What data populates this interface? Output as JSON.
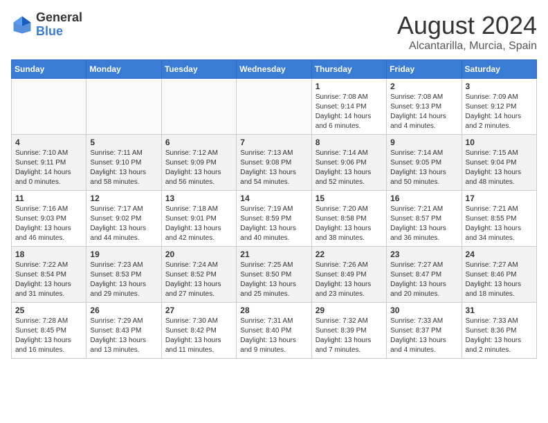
{
  "header": {
    "logo": {
      "general": "General",
      "blue": "Blue"
    },
    "title": "August 2024",
    "location": "Alcantarilla, Murcia, Spain"
  },
  "calendar": {
    "weekdays": [
      "Sunday",
      "Monday",
      "Tuesday",
      "Wednesday",
      "Thursday",
      "Friday",
      "Saturday"
    ],
    "weeks": [
      [
        {
          "day": "",
          "info": ""
        },
        {
          "day": "",
          "info": ""
        },
        {
          "day": "",
          "info": ""
        },
        {
          "day": "",
          "info": ""
        },
        {
          "day": "1",
          "info": "Sunrise: 7:08 AM\nSunset: 9:14 PM\nDaylight: 14 hours\nand 6 minutes."
        },
        {
          "day": "2",
          "info": "Sunrise: 7:08 AM\nSunset: 9:13 PM\nDaylight: 14 hours\nand 4 minutes."
        },
        {
          "day": "3",
          "info": "Sunrise: 7:09 AM\nSunset: 9:12 PM\nDaylight: 14 hours\nand 2 minutes."
        }
      ],
      [
        {
          "day": "4",
          "info": "Sunrise: 7:10 AM\nSunset: 9:11 PM\nDaylight: 14 hours\nand 0 minutes."
        },
        {
          "day": "5",
          "info": "Sunrise: 7:11 AM\nSunset: 9:10 PM\nDaylight: 13 hours\nand 58 minutes."
        },
        {
          "day": "6",
          "info": "Sunrise: 7:12 AM\nSunset: 9:09 PM\nDaylight: 13 hours\nand 56 minutes."
        },
        {
          "day": "7",
          "info": "Sunrise: 7:13 AM\nSunset: 9:08 PM\nDaylight: 13 hours\nand 54 minutes."
        },
        {
          "day": "8",
          "info": "Sunrise: 7:14 AM\nSunset: 9:06 PM\nDaylight: 13 hours\nand 52 minutes."
        },
        {
          "day": "9",
          "info": "Sunrise: 7:14 AM\nSunset: 9:05 PM\nDaylight: 13 hours\nand 50 minutes."
        },
        {
          "day": "10",
          "info": "Sunrise: 7:15 AM\nSunset: 9:04 PM\nDaylight: 13 hours\nand 48 minutes."
        }
      ],
      [
        {
          "day": "11",
          "info": "Sunrise: 7:16 AM\nSunset: 9:03 PM\nDaylight: 13 hours\nand 46 minutes."
        },
        {
          "day": "12",
          "info": "Sunrise: 7:17 AM\nSunset: 9:02 PM\nDaylight: 13 hours\nand 44 minutes."
        },
        {
          "day": "13",
          "info": "Sunrise: 7:18 AM\nSunset: 9:01 PM\nDaylight: 13 hours\nand 42 minutes."
        },
        {
          "day": "14",
          "info": "Sunrise: 7:19 AM\nSunset: 8:59 PM\nDaylight: 13 hours\nand 40 minutes."
        },
        {
          "day": "15",
          "info": "Sunrise: 7:20 AM\nSunset: 8:58 PM\nDaylight: 13 hours\nand 38 minutes."
        },
        {
          "day": "16",
          "info": "Sunrise: 7:21 AM\nSunset: 8:57 PM\nDaylight: 13 hours\nand 36 minutes."
        },
        {
          "day": "17",
          "info": "Sunrise: 7:21 AM\nSunset: 8:55 PM\nDaylight: 13 hours\nand 34 minutes."
        }
      ],
      [
        {
          "day": "18",
          "info": "Sunrise: 7:22 AM\nSunset: 8:54 PM\nDaylight: 13 hours\nand 31 minutes."
        },
        {
          "day": "19",
          "info": "Sunrise: 7:23 AM\nSunset: 8:53 PM\nDaylight: 13 hours\nand 29 minutes."
        },
        {
          "day": "20",
          "info": "Sunrise: 7:24 AM\nSunset: 8:52 PM\nDaylight: 13 hours\nand 27 minutes."
        },
        {
          "day": "21",
          "info": "Sunrise: 7:25 AM\nSunset: 8:50 PM\nDaylight: 13 hours\nand 25 minutes."
        },
        {
          "day": "22",
          "info": "Sunrise: 7:26 AM\nSunset: 8:49 PM\nDaylight: 13 hours\nand 23 minutes."
        },
        {
          "day": "23",
          "info": "Sunrise: 7:27 AM\nSunset: 8:47 PM\nDaylight: 13 hours\nand 20 minutes."
        },
        {
          "day": "24",
          "info": "Sunrise: 7:27 AM\nSunset: 8:46 PM\nDaylight: 13 hours\nand 18 minutes."
        }
      ],
      [
        {
          "day": "25",
          "info": "Sunrise: 7:28 AM\nSunset: 8:45 PM\nDaylight: 13 hours\nand 16 minutes."
        },
        {
          "day": "26",
          "info": "Sunrise: 7:29 AM\nSunset: 8:43 PM\nDaylight: 13 hours\nand 13 minutes."
        },
        {
          "day": "27",
          "info": "Sunrise: 7:30 AM\nSunset: 8:42 PM\nDaylight: 13 hours\nand 11 minutes."
        },
        {
          "day": "28",
          "info": "Sunrise: 7:31 AM\nSunset: 8:40 PM\nDaylight: 13 hours\nand 9 minutes."
        },
        {
          "day": "29",
          "info": "Sunrise: 7:32 AM\nSunset: 8:39 PM\nDaylight: 13 hours\nand 7 minutes."
        },
        {
          "day": "30",
          "info": "Sunrise: 7:33 AM\nSunset: 8:37 PM\nDaylight: 13 hours\nand 4 minutes."
        },
        {
          "day": "31",
          "info": "Sunrise: 7:33 AM\nSunset: 8:36 PM\nDaylight: 13 hours\nand 2 minutes."
        }
      ]
    ]
  }
}
